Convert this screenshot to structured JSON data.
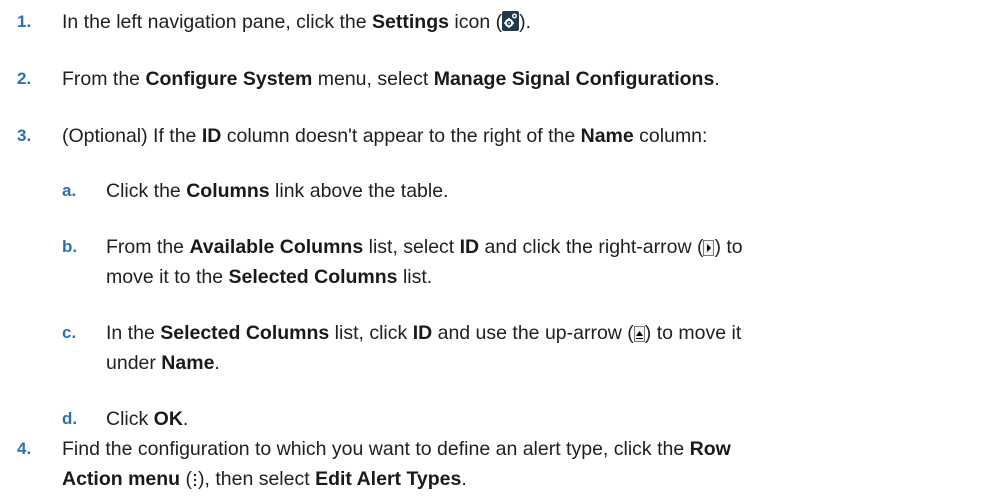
{
  "steps": [
    {
      "num": "1.",
      "t1": "In the left navigation pane, click the ",
      "b1": "Settings",
      "t2": " icon (",
      "t3": ")."
    },
    {
      "num": "2.",
      "t1": "From the ",
      "b1": "Configure System",
      "t2": " menu, select ",
      "b2": "Manage Signal Configurations",
      "t3": "."
    },
    {
      "num": "3.",
      "t1": "(Optional) If the ",
      "b1": "ID",
      "t2": " column doesn't appear to the right of the ",
      "b2": "Name",
      "t3": " column:"
    },
    {
      "num": "4.",
      "t1": "Find the configuration to which you want to define an alert type, click the ",
      "b1": "Row",
      "b1b": "Action menu",
      "t2": " (",
      "t3": "), then select ",
      "b2": "Edit Alert Types",
      "t4": "."
    }
  ],
  "substeps": [
    {
      "num": "a.",
      "t1": "Click the ",
      "b1": "Columns",
      "t2": " link above the table."
    },
    {
      "num": "b.",
      "t1": "From the ",
      "b1": "Available Columns",
      "t2": " list, select ",
      "b2": "ID",
      "t3": " and click the right-arrow (",
      "t4": ") to",
      "t5": "move it to the ",
      "b3": "Selected Columns",
      "t6": " list."
    },
    {
      "num": "c.",
      "t1": "In the ",
      "b1": "Selected Columns",
      "t2": " list, click ",
      "b2": "ID",
      "t3": " and use the up-arrow (",
      "t4": ") to move it",
      "t5": "under ",
      "b3": "Name",
      "t6": "."
    },
    {
      "num": "d.",
      "t1": "Click ",
      "b1": "OK",
      "t2": "."
    }
  ],
  "icons": {
    "settings": "settings-gear-icon",
    "right_arrow": "right-arrow-button-icon",
    "up_arrow": "up-arrow-button-icon",
    "row_action": "vertical-ellipsis-icon"
  },
  "colors": {
    "step_number": "#2e6fb5",
    "text": "#1f1f1f",
    "settings_icon_bg": "#22384f"
  }
}
